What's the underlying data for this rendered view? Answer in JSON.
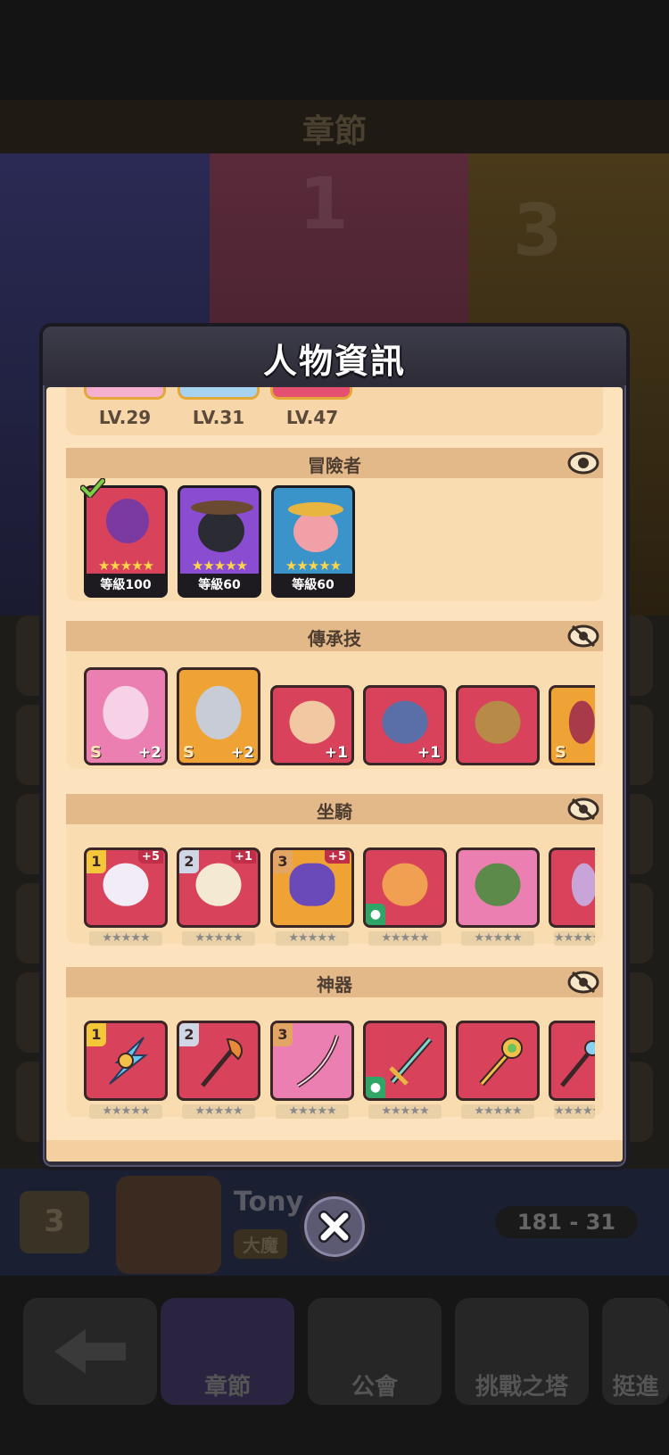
{
  "background": {
    "title": "章節",
    "banner_numbers": [
      "1",
      "3"
    ],
    "player_name": "Tony",
    "player_tag": "大魔",
    "crown_rank": "3",
    "score": "181 - 31",
    "nav": [
      "章節",
      "公會",
      "挑戰之塔",
      "挺進"
    ]
  },
  "modal": {
    "title": "人物資訊",
    "top_levels": [
      "LV.29",
      "LV.31",
      "LV.47"
    ],
    "adventurers": {
      "title": "冒險者",
      "eye_icon": "eye-icon",
      "items": [
        {
          "level": "等級100",
          "stars": "★★★★★",
          "color": "#d8425a",
          "checked": true
        },
        {
          "level": "等級60",
          "stars": "★★★★★",
          "color": "#8a4cd0",
          "checked": false
        },
        {
          "level": "等級60",
          "stars": "★★★★★",
          "color": "#3b94c9",
          "checked": false
        }
      ]
    },
    "legacy_skills": {
      "title": "傳承技",
      "eye_icon": "eye-off-icon",
      "items": [
        {
          "grade": "S",
          "plus": "+2"
        },
        {
          "grade": "S",
          "plus": "+2"
        },
        {
          "grade": "",
          "plus": "+1"
        },
        {
          "grade": "",
          "plus": "+1"
        },
        {
          "grade": "",
          "plus": ""
        },
        {
          "grade": "S",
          "plus": ""
        }
      ]
    },
    "mounts": {
      "title": "坐騎",
      "eye_icon": "eye-off-icon",
      "items": [
        {
          "rank": "1",
          "plus": "+5"
        },
        {
          "rank": "2",
          "plus": "+1"
        },
        {
          "rank": "3",
          "plus": "+5"
        },
        {
          "rank": "",
          "plus": ""
        },
        {
          "rank": "",
          "plus": ""
        },
        {
          "rank": "",
          "plus": ""
        }
      ],
      "stars": "★★★★★"
    },
    "artifacts": {
      "title": "神器",
      "eye_icon": "eye-off-icon",
      "items": [
        {
          "rank": "1"
        },
        {
          "rank": "2"
        },
        {
          "rank": "3"
        },
        {
          "rank": ""
        },
        {
          "rank": ""
        },
        {
          "rank": ""
        }
      ],
      "stars": "★★★★★"
    },
    "close_icon": "close-icon"
  }
}
